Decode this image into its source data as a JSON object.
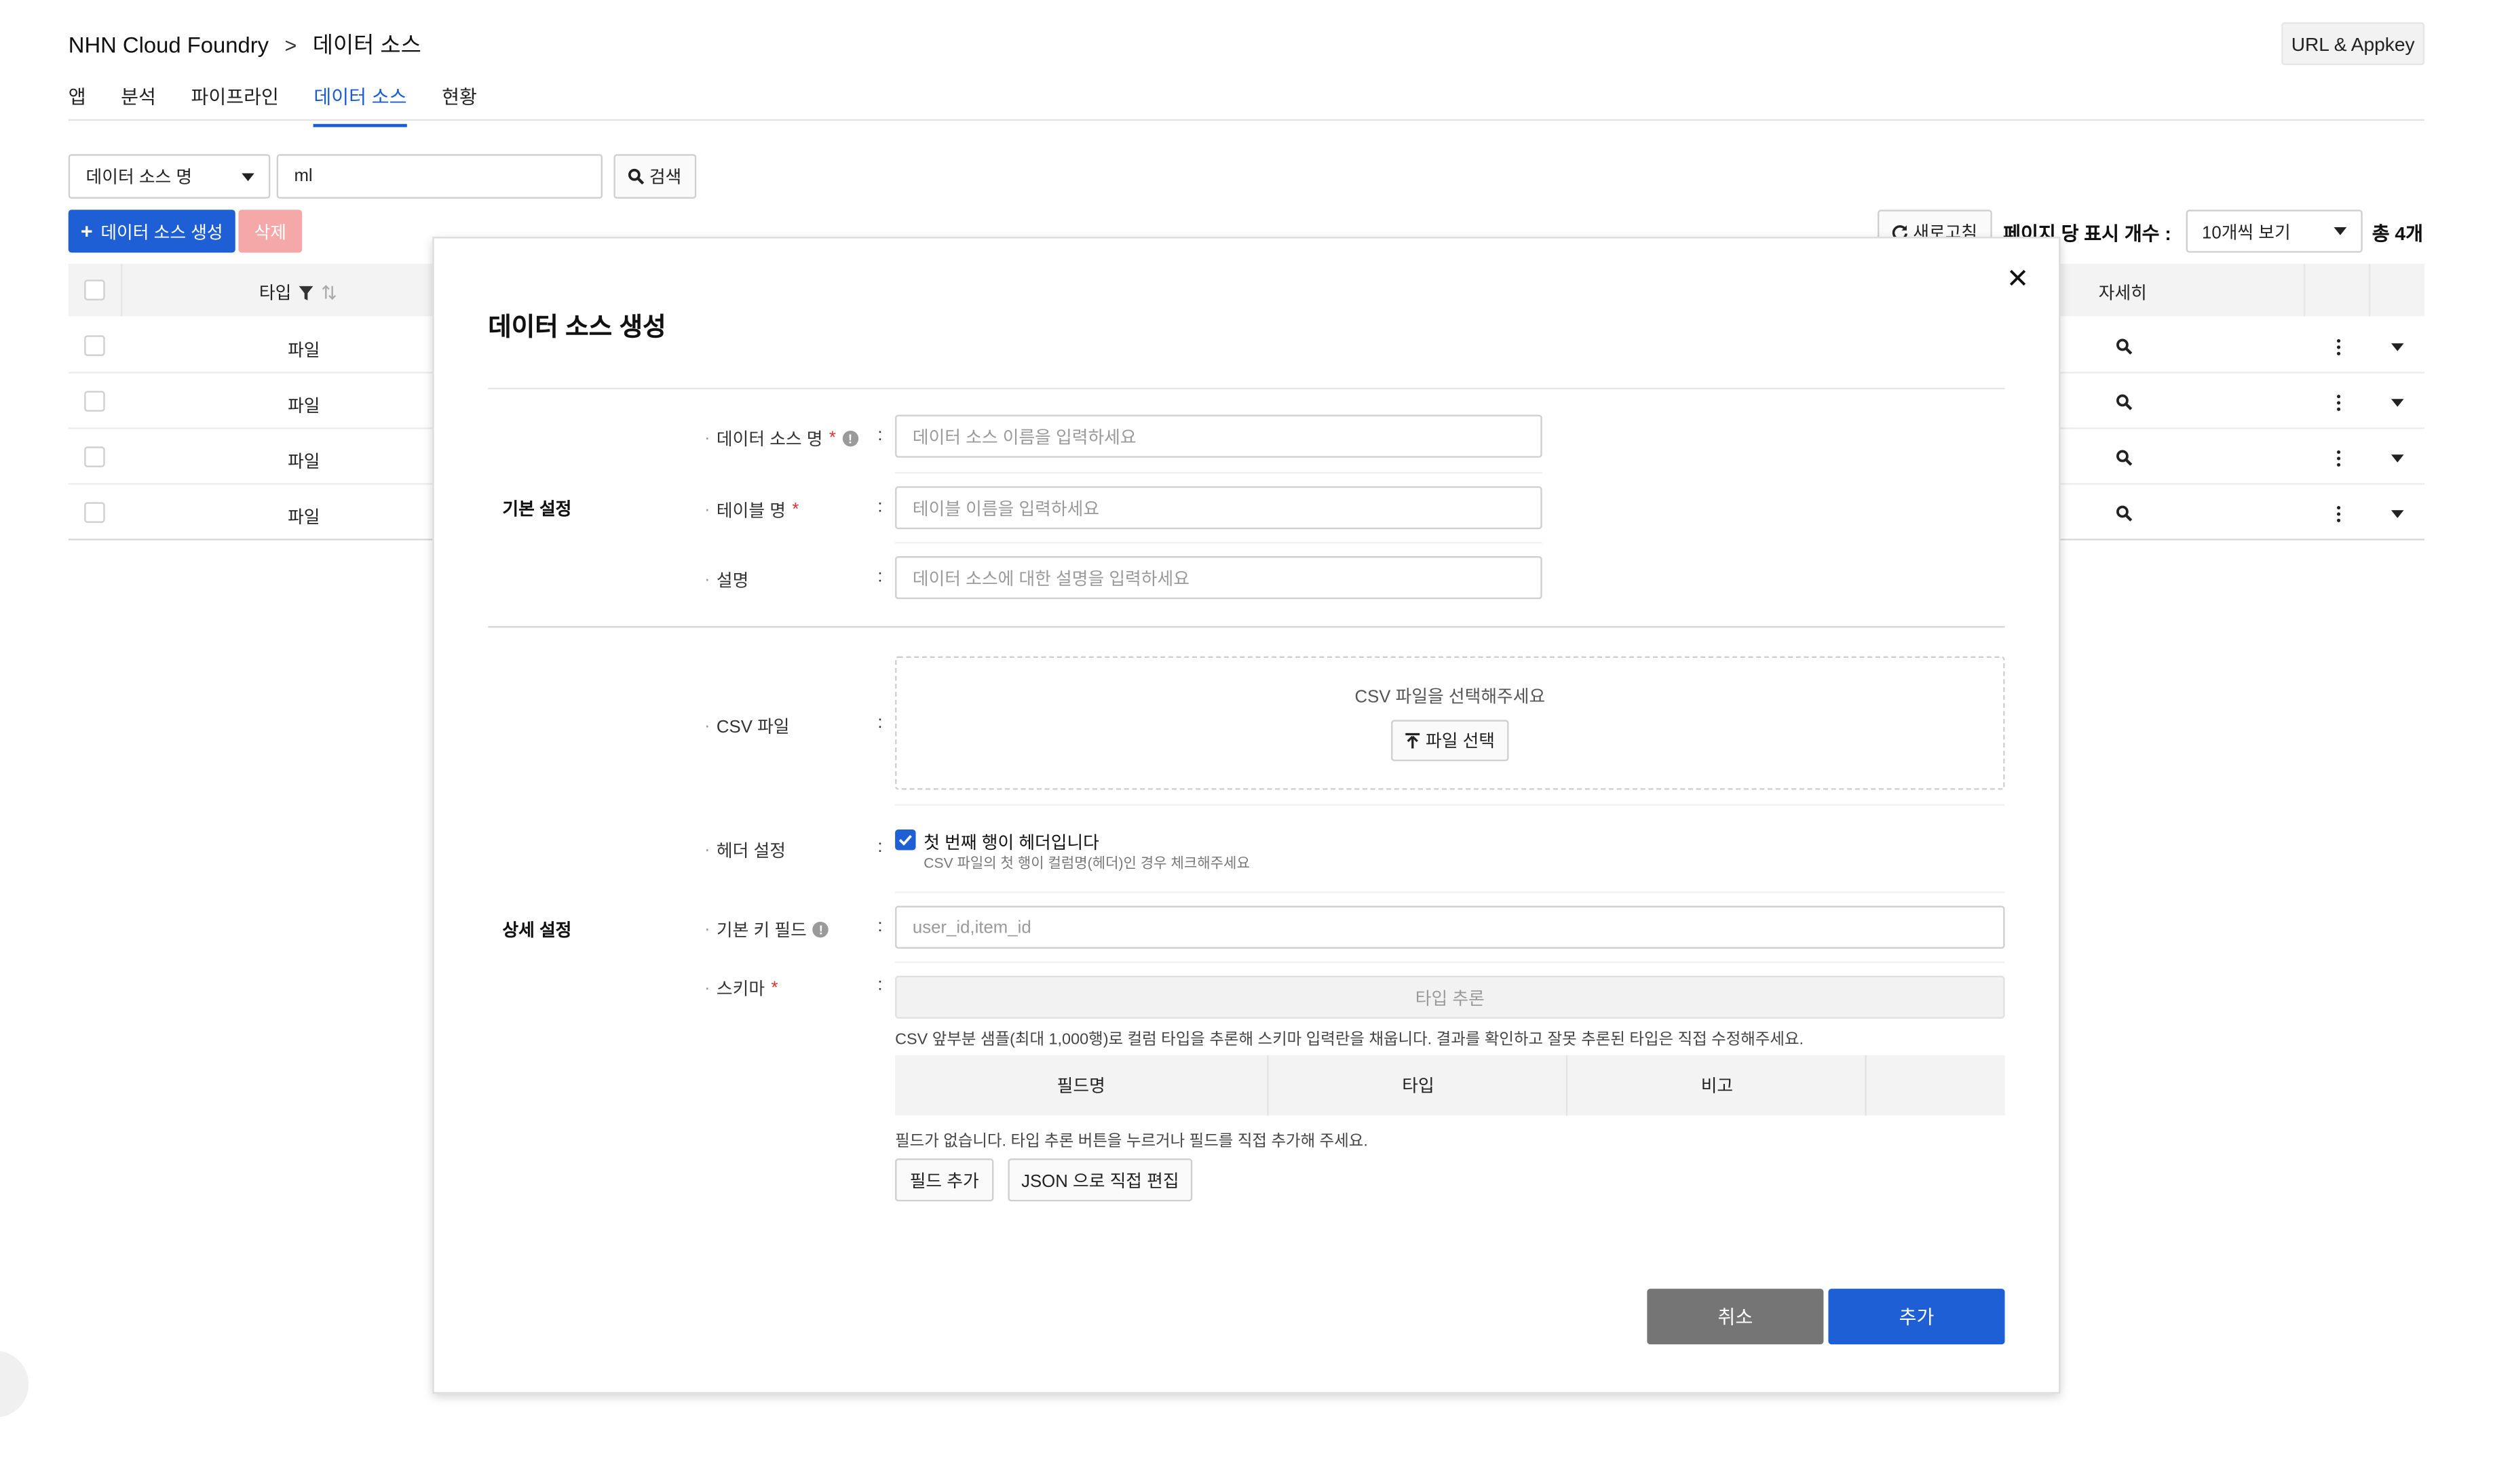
{
  "breadcrumb": {
    "root": "NHN Cloud Foundry",
    "separator": ">",
    "current": "데이터 소스"
  },
  "header": {
    "url_appkey_label": "URL & Appkey"
  },
  "tabs": [
    {
      "label": "앱",
      "active": false
    },
    {
      "label": "분석",
      "active": false
    },
    {
      "label": "파이프라인",
      "active": false
    },
    {
      "label": "데이터 소스",
      "active": true
    },
    {
      "label": "현황",
      "active": false
    }
  ],
  "search": {
    "select_value": "데이터 소스 명",
    "input_value": "ml",
    "button_label": "검색"
  },
  "actions": {
    "create_label": "데이터 소스 생성",
    "delete_label": "삭제",
    "refresh_label": "새로고침"
  },
  "paging": {
    "per_page_label": "페이지 당 표시 개수 :",
    "per_page_value": "10개씩 보기",
    "total": "총 4개"
  },
  "table": {
    "columns": {
      "type": "타입",
      "detail": "자세히"
    },
    "rows": [
      {
        "type": "파일"
      },
      {
        "type": "파일"
      },
      {
        "type": "파일"
      },
      {
        "type": "파일"
      }
    ]
  },
  "modal": {
    "title": "데이터 소스 생성",
    "basic": {
      "section_label": "기본 설정",
      "name_label": "데이터 소스 명",
      "name_placeholder": "데이터 소스 이름을 입력하세요",
      "table_label": "테이블 명",
      "table_placeholder": "테이블 이름을 입력하세요",
      "desc_label": "설명",
      "desc_placeholder": "데이터 소스에 대한 설명을 입력하세요"
    },
    "detail": {
      "section_label": "상세 설정",
      "csv_label": "CSV 파일",
      "csv_prompt": "CSV 파일을 선택해주세요",
      "file_button": "파일 선택",
      "header_label": "헤더 설정",
      "header_checkbox_label": "첫 번째 행이 헤더입니다",
      "header_checked": true,
      "header_help": "CSV 파일의 첫 행이 컬럼명(헤더)인 경우 체크해주세요",
      "key_label": "기본 키 필드",
      "key_placeholder": "user_id,item_id",
      "schema_label": "스키마",
      "infer_button": "타입 추론",
      "schema_help": "CSV 앞부분 샘플(최대 1,000행)로 컬럼 타입을 추론해 스키마 입력란을 채웁니다. 결과를 확인하고 잘못 추론된 타입은 직접 수정해주세요.",
      "schema_columns": {
        "field": "필드명",
        "type": "타입",
        "note": "비고"
      },
      "empty_text": "필드가 없습니다. 타입 추론 버튼을 누르거나 필드를 직접 추가해 주세요.",
      "add_field_button": "필드 추가",
      "json_edit_button": "JSON 으로 직접 편집"
    },
    "cancel_label": "취소",
    "submit_label": "추가",
    "required_mark": "*",
    "colon": ":",
    "bullet": "·"
  },
  "colors": {
    "primary": "#1f5fd6",
    "danger_light": "#f4a8a8",
    "cancel": "#757575"
  }
}
